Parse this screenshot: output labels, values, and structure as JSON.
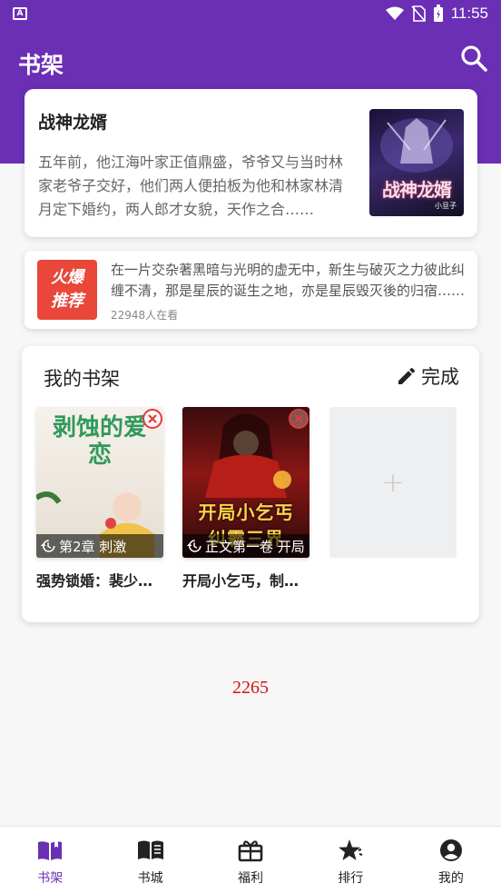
{
  "status_bar": {
    "time": "11:55"
  },
  "app_bar": {
    "title": "书架"
  },
  "featured": {
    "title": "战神龙婿",
    "description": "五年前，他江海叶家正值鼎盛，爷爷又与当时林家老爷子交好，他们两人便拍板为他和林家林清月定下婚约，两人郎才女貌，天作之合……",
    "cover_text": "战神龙婿",
    "cover_author": "小旦子"
  },
  "promo": {
    "badge_line1": "火爆",
    "badge_line2": "推荐",
    "description": "在一片交杂著黑暗与光明的虚无中，新生与破灭之力彼此纠缠不清，那是星辰的诞生之地，亦是星辰毁灭後的归宿……",
    "readers": "22948人在看"
  },
  "shelf": {
    "title": "我的书架",
    "done_label": "完成",
    "books": [
      {
        "name": "强势锁婚：裴少的宠妻",
        "progress": "第2章 刺激",
        "cover_title": "剥蚀的爱恋"
      },
      {
        "name": "开局小乞丐，制霸三界",
        "progress": "正文第一卷 开局",
        "cover_title": "开局小乞丐 纠霸三界"
      }
    ],
    "add_label": "+"
  },
  "counter": "2265",
  "bottom_nav": [
    {
      "label": "书架",
      "icon": "open-book-icon",
      "active": true
    },
    {
      "label": "书城",
      "icon": "book-icon",
      "active": false
    },
    {
      "label": "福利",
      "icon": "gift-icon",
      "active": false
    },
    {
      "label": "排行",
      "icon": "star-rank-icon",
      "active": false
    },
    {
      "label": "我的",
      "icon": "user-icon",
      "active": false
    }
  ],
  "colors": {
    "primary": "#6a2fb5",
    "promo_red": "#e8473a",
    "counter_red": "#d21414"
  }
}
